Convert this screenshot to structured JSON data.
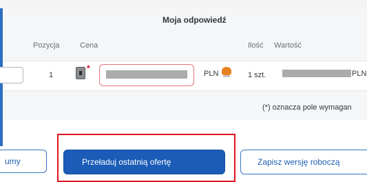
{
  "section": {
    "title": "Moja odpowiedź"
  },
  "columns": {
    "pozycja": "Pozycja",
    "cena": "Cena",
    "ilosc": "Ilość",
    "wartosc": "Wartość"
  },
  "row": {
    "position": "1",
    "price_currency": "PLN",
    "quantity": "1 szt.",
    "value_currency": "PLN",
    "icons": {
      "attachment": "document-icon",
      "price_info": "coin-icon"
    }
  },
  "note": "(*) oznacza pole wymagan",
  "buttons": {
    "left_partial": "umy",
    "reload": "Przeładuj ostatnią ofertę",
    "save_draft": "Zapisz wersję roboczą"
  },
  "colors": {
    "accent": "#1a5cb8",
    "required": "#d0021b",
    "highlight_frame": "#e0151e"
  }
}
